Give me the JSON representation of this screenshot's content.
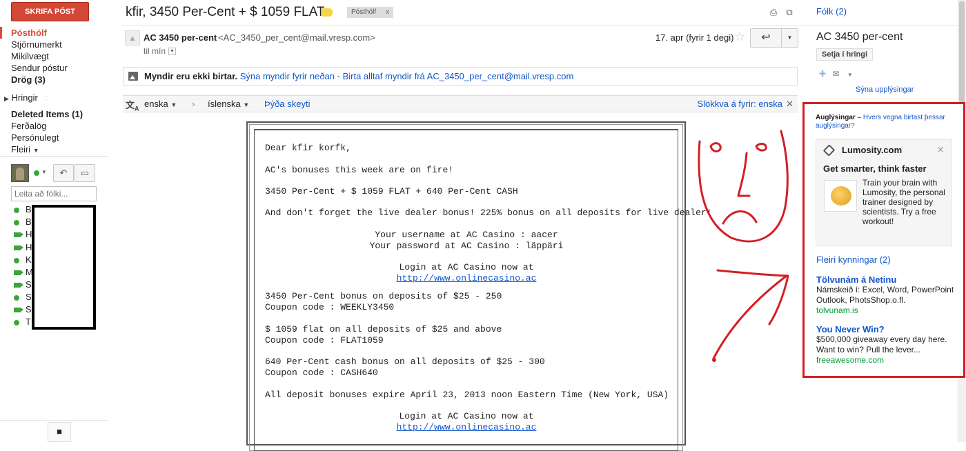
{
  "left_nav": {
    "compose_label": "SKRIFA PÓST",
    "items": [
      {
        "label": "Pósthólf"
      },
      {
        "label": "Stjörnumerkt"
      },
      {
        "label": "Mikilvægt"
      },
      {
        "label": "Sendur póstur"
      },
      {
        "label": "Drög (3)"
      }
    ],
    "circles_label": "Hringir",
    "labels": [
      {
        "label": "Deleted Items (1)"
      },
      {
        "label": "Ferðalög"
      },
      {
        "label": "Persónulegt"
      },
      {
        "label": "Fleiri"
      }
    ],
    "chat_search_placeholder": "Leita að fólki...",
    "contacts": [
      {
        "initial": "B",
        "status": "online"
      },
      {
        "initial": "B",
        "status": "online"
      },
      {
        "initial": "H",
        "status": "video"
      },
      {
        "initial": "H",
        "status": "video"
      },
      {
        "initial": "K",
        "status": "online"
      },
      {
        "initial": "M",
        "status": "video"
      },
      {
        "initial": "S",
        "status": "video"
      },
      {
        "initial": "S",
        "status": "online"
      },
      {
        "initial": "S",
        "status": "video"
      },
      {
        "initial": "T",
        "status": "online"
      }
    ]
  },
  "header": {
    "subject": "kfir, 3450 Per-Cent + $ 1059 FLAT",
    "inbox_chip": "Pósthólf",
    "inbox_chip_close": "x"
  },
  "message": {
    "sender_name": "AC 3450 per-cent",
    "sender_email": "<AC_3450_per_cent@mail.vresp.com>",
    "to": "til mín",
    "date": "17. apr (fyrir 1 degi)",
    "images_notice_bold": "Myndir eru ekki birtar.",
    "images_show_link": "Sýna myndir fyrir neðan",
    "images_dash": " - ",
    "images_always_link": "Birta alltaf myndir frá AC_3450_per_cent@mail.vresp.com",
    "translate": {
      "from_lang": "enska",
      "to_lang": "íslenska",
      "translate_link": "Þýða skeyti",
      "disable_link": "Slökkva á fyrir: enska"
    },
    "body": {
      "greeting": "Dear kfir korfk,",
      "line1": "AC's bonuses this week are on fire!",
      "line2": "3450 Per-Cent + $ 1059 FLAT + 640 Per-Cent CASH",
      "line3": "And don't forget the live dealer bonus! 225% bonus on all deposits for live dealer!",
      "username": "Your username at AC Casino : aacer",
      "password": "Your password at AC Casino : läppäri",
      "login1": "Login at AC Casino now at",
      "url1": "http://www.onlinecasino.ac",
      "bonus1": "3450 Per-Cent bonus on deposits of $25 - 250",
      "coupon1": "Coupon code : WEEKLY3450",
      "bonus2": "$ 1059 flat on all deposits of $25 and above",
      "coupon2": "Coupon code : FLAT1059",
      "bonus3": "640 Per-Cent cash bonus on all deposits of $25 - 300",
      "coupon3": "Coupon code : CASH640",
      "expire": "All deposit bonuses expire April 23, 2013 noon Eastern Time (New York, USA)",
      "login2": "Login at AC Casino now at",
      "url2": "http://www.onlinecasino.ac"
    }
  },
  "right_sidebar": {
    "people_link": "Fólk (2)",
    "contact_name": "AC 3450 per-cent",
    "add_to_circles": "Setja í hringi",
    "show_details": "Sýna upplýsingar",
    "ads_label": "Auglýsingar",
    "ads_why": "Hvers vegna birtast þessar auglýsingar?",
    "ads_dash": " – ",
    "lumosity": {
      "domain": "Lumosity.com",
      "title": "Get smarter, think faster",
      "text": "Train your brain with Lumosity, the personal trainer designed by scientists. Try a free workout!"
    },
    "more_offers": "Fleiri kynningar (2)",
    "ads": [
      {
        "title": "Tölvunám á Netinu",
        "text": "Námskeið í: Excel, Word, PowerPoint Outlook, PhotsShop.o.fl.",
        "url": "tolvunam.is"
      },
      {
        "title": "You Never Win?",
        "text": "$500,000 giveaway every day here. Want to win? Pull the lever...",
        "url": "freeawesome.com"
      }
    ]
  },
  "colors": {
    "compose": "#d14836",
    "link": "#1155cc",
    "annotation_red": "#d31e25",
    "online_green": "#3ba53b",
    "ad_url_green": "#009933"
  },
  "icons": [
    "print-icon",
    "new-window-icon",
    "star-icon",
    "reply-icon",
    "more-dropdown-icon",
    "image-icon",
    "translate-icon",
    "tag-icon",
    "close-icon",
    "mail-icon",
    "add-person-icon",
    "chat-bubble-icon",
    "phone-icon"
  ]
}
